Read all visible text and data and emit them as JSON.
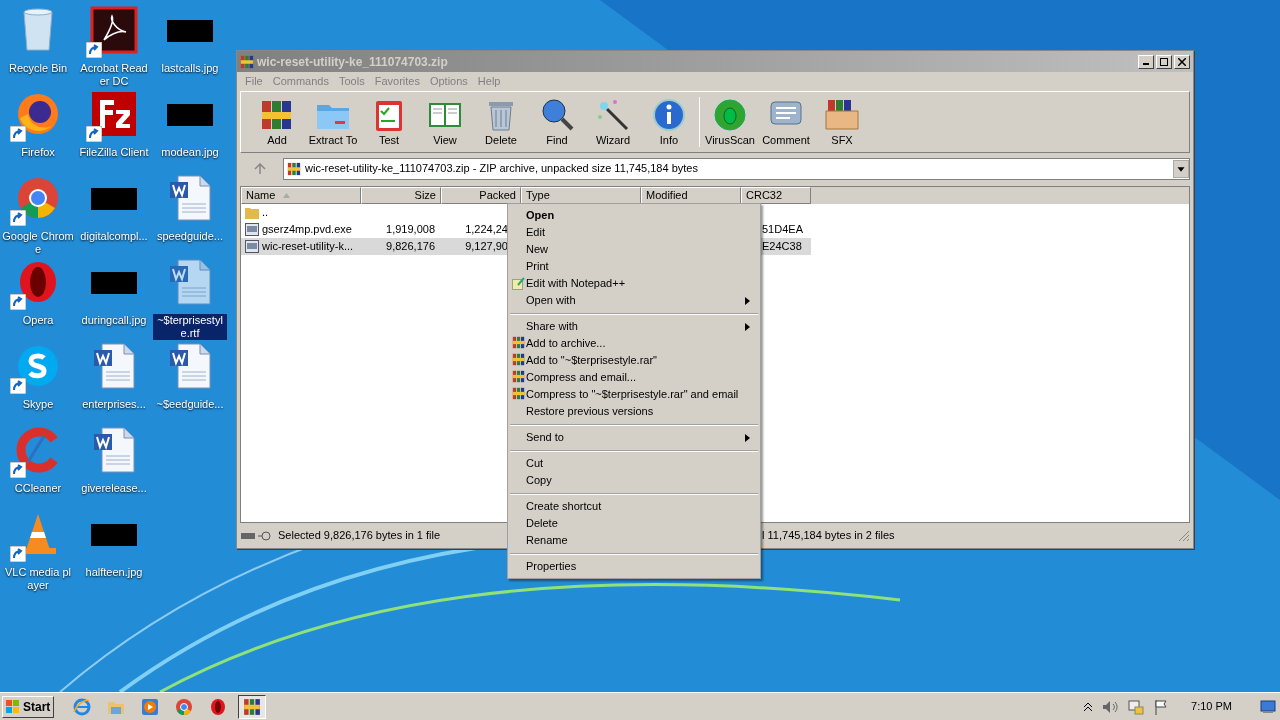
{
  "desktop_icons": [
    {
      "label": "Recycle Bin",
      "kind": "recycle",
      "shortcut": false,
      "selected": false
    },
    {
      "label": "Firefox",
      "kind": "firefox",
      "shortcut": true,
      "selected": false
    },
    {
      "label": "Google Chrome",
      "kind": "chrome",
      "shortcut": true,
      "selected": false
    },
    {
      "label": "Opera",
      "kind": "opera",
      "shortcut": true,
      "selected": false
    },
    {
      "label": "Skype",
      "kind": "skype",
      "shortcut": true,
      "selected": false
    },
    {
      "label": "CCleaner",
      "kind": "ccleaner",
      "shortcut": true,
      "selected": false
    },
    {
      "label": "VLC media player",
      "kind": "vlc",
      "shortcut": true,
      "selected": false
    },
    {
      "label": "Acrobat Reader DC",
      "kind": "acrobat",
      "shortcut": true,
      "selected": false
    },
    {
      "label": "FileZilla Client",
      "kind": "filezilla",
      "shortcut": true,
      "selected": false
    },
    {
      "label": "digitalcompl...",
      "kind": "redacted",
      "shortcut": false,
      "selected": false
    },
    {
      "label": "duringcall.jpg",
      "kind": "redacted",
      "shortcut": false,
      "selected": false
    },
    {
      "label": "enterprises...",
      "kind": "word",
      "shortcut": false,
      "selected": false
    },
    {
      "label": "giverelease...",
      "kind": "word",
      "shortcut": false,
      "selected": false
    },
    {
      "label": "halfteen.jpg",
      "kind": "redacted",
      "shortcut": false,
      "selected": false
    },
    {
      "label": "lastcalls.jpg",
      "kind": "redacted",
      "shortcut": false,
      "selected": false
    },
    {
      "label": "modean.jpg",
      "kind": "redacted",
      "shortcut": false,
      "selected": false
    },
    {
      "label": "speedguide...",
      "kind": "word",
      "shortcut": false,
      "selected": false
    },
    {
      "label": "~$terprisestyle.rtf",
      "kind": "word_faded",
      "shortcut": false,
      "selected": true
    },
    {
      "label": "~$eedguide...",
      "kind": "word",
      "shortcut": false,
      "selected": false
    }
  ],
  "window": {
    "title": "wic-reset-utility-ke_111074703.zip",
    "active": false,
    "menu": [
      "File",
      "Commands",
      "Tools",
      "Favorites",
      "Options",
      "Help"
    ],
    "toolbar": [
      {
        "label": "Add",
        "kind": "add"
      },
      {
        "label": "Extract To",
        "kind": "extract"
      },
      {
        "label": "Test",
        "kind": "test"
      },
      {
        "label": "View",
        "kind": "view"
      },
      {
        "label": "Delete",
        "kind": "delete"
      },
      {
        "label": "Find",
        "kind": "find"
      },
      {
        "label": "Wizard",
        "kind": "wizard"
      },
      {
        "label": "Info",
        "kind": "info"
      },
      {
        "kind": "separator"
      },
      {
        "label": "VirusScan",
        "kind": "virus"
      },
      {
        "label": "Comment",
        "kind": "comment"
      },
      {
        "label": "SFX",
        "kind": "sfx"
      }
    ],
    "address": "wic-reset-utility-ke_111074703.zip - ZIP archive, unpacked size 11,745,184 bytes",
    "columns": [
      "Name",
      "Size",
      "Packed",
      "Type",
      "Modified",
      "CRC32"
    ],
    "rows": [
      {
        "kind": "folder",
        "name": "..",
        "size": "",
        "packed": "",
        "crc": "",
        "selected": false
      },
      {
        "kind": "file",
        "name": "gserz4mp.pvd.exe",
        "size": "1,919,008",
        "packed": "1,224,24",
        "crc": "51D4EA",
        "selected": false
      },
      {
        "kind": "file",
        "name": "wic-reset-utility-k...",
        "size": "9,826,176",
        "packed": "9,127,90",
        "crc": "E24C38",
        "selected": true
      }
    ],
    "status_left": "Selected 9,826,176 bytes in 1 file",
    "status_right": "l 11,745,184 bytes in 2 files"
  },
  "context_menu": [
    {
      "kind": "item",
      "label": "Open",
      "default": true,
      "submenu": false
    },
    {
      "kind": "item",
      "label": "Edit",
      "default": false,
      "submenu": false
    },
    {
      "kind": "item",
      "label": "New",
      "default": false,
      "submenu": false
    },
    {
      "kind": "item",
      "label": "Print",
      "default": false,
      "submenu": false
    },
    {
      "kind": "notepad_item",
      "label": "Edit with Notepad++",
      "default": false,
      "submenu": false
    },
    {
      "kind": "item",
      "label": "Open with",
      "default": false,
      "submenu": true
    },
    {
      "kind": "separator"
    },
    {
      "kind": "item",
      "label": "Share with",
      "default": false,
      "submenu": true
    },
    {
      "kind": "winrar_item",
      "label": "Add to archive...",
      "default": false,
      "submenu": false
    },
    {
      "kind": "winrar_item",
      "label": "Add to \"~$terprisestyle.rar\"",
      "default": false,
      "submenu": false
    },
    {
      "kind": "winrar_item",
      "label": "Compress and email...",
      "default": false,
      "submenu": false
    },
    {
      "kind": "winrar_item",
      "label": "Compress to \"~$terprisestyle.rar\" and email",
      "default": false,
      "submenu": false
    },
    {
      "kind": "item",
      "label": "Restore previous versions",
      "default": false,
      "submenu": false
    },
    {
      "kind": "separator"
    },
    {
      "kind": "item",
      "label": "Send to",
      "default": false,
      "submenu": true
    },
    {
      "kind": "separator"
    },
    {
      "kind": "item",
      "label": "Cut",
      "default": false,
      "submenu": false
    },
    {
      "kind": "item",
      "label": "Copy",
      "default": false,
      "submenu": false
    },
    {
      "kind": "separator"
    },
    {
      "kind": "item",
      "label": "Create shortcut",
      "default": false,
      "submenu": false
    },
    {
      "kind": "item",
      "label": "Delete",
      "default": false,
      "submenu": false
    },
    {
      "kind": "item",
      "label": "Rename",
      "default": false,
      "submenu": false
    },
    {
      "kind": "separator"
    },
    {
      "kind": "item",
      "label": "Properties",
      "default": false,
      "submenu": false
    }
  ],
  "taskbar": {
    "start": "Start",
    "apps": [
      {
        "kind": "ie",
        "selected": false
      },
      {
        "kind": "explorer",
        "selected": false
      },
      {
        "kind": "media",
        "selected": false
      },
      {
        "kind": "chrome",
        "selected": false
      },
      {
        "kind": "opera",
        "selected": false
      },
      {
        "kind": "winrar",
        "selected": true
      }
    ],
    "clock": "7:10 PM"
  }
}
